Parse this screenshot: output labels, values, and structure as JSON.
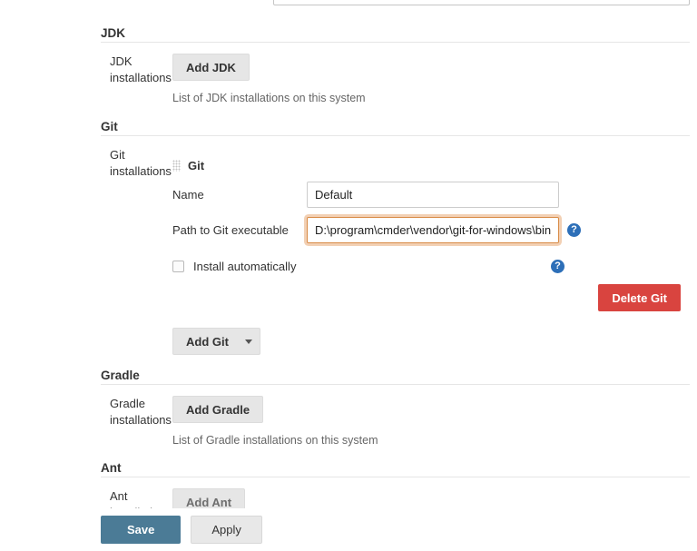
{
  "page": {
    "top_cut_field": {
      "name": "partially-visible-text-field",
      "value": ""
    }
  },
  "sections": {
    "jdk": {
      "heading": "JDK",
      "row_label": "JDK installations",
      "add_button": "Add JDK",
      "help_text": "List of JDK installations on this system"
    },
    "git": {
      "heading": "Git",
      "row_label": "Git installations",
      "installation": {
        "grip_label": "Git",
        "name_label": "Name",
        "name_value": "Default",
        "path_label": "Path to Git executable",
        "path_value": "D:\\program\\cmder\\vendor\\git-for-windows\\bin",
        "install_automatically_label": "Install automatically",
        "install_automatically_checked": false,
        "delete_button": "Delete Git",
        "help_icon": "help-icon"
      },
      "add_button": "Add Git",
      "add_button_caret": "chevron-down-icon"
    },
    "gradle": {
      "heading": "Gradle",
      "row_label": "Gradle installations",
      "add_button": "Add Gradle",
      "help_text": "List of Gradle installations on this system"
    },
    "ant": {
      "heading": "Ant",
      "row_label": "Ant installations",
      "add_button": "Add Ant"
    }
  },
  "footer": {
    "save_label": "Save",
    "apply_label": "Apply"
  },
  "colors": {
    "danger": "#d9443f",
    "primary": "#4b7b96",
    "focus_ring": "#d88b46",
    "help_icon": "#2d6fb8"
  }
}
